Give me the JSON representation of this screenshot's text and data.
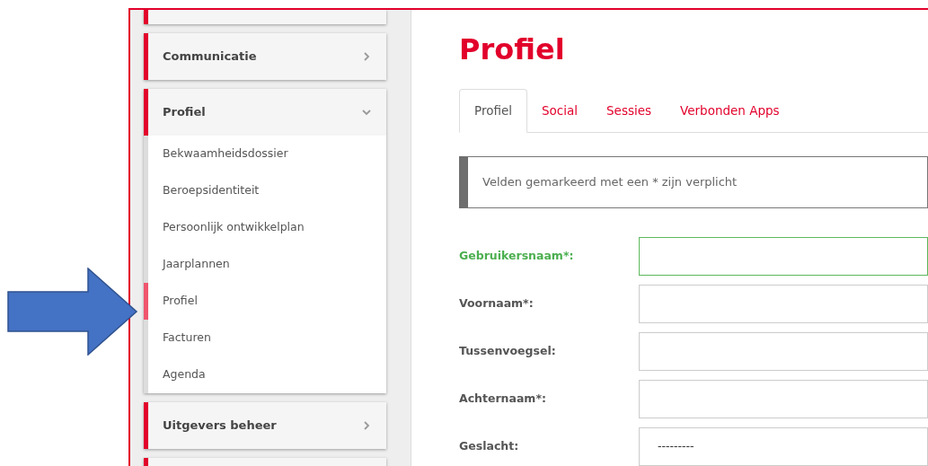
{
  "sidebar": {
    "groups": [
      {
        "label": "Communicatie",
        "expanded": false
      },
      {
        "label": "Profiel",
        "expanded": true,
        "items": [
          {
            "label": "Bekwaamheidsdossier",
            "selected": false
          },
          {
            "label": "Beroepsidentiteit",
            "selected": false
          },
          {
            "label": "Persoonlijk ontwikkelplan",
            "selected": false
          },
          {
            "label": "Jaarplannen",
            "selected": false
          },
          {
            "label": "Profiel",
            "selected": true
          },
          {
            "label": "Facturen",
            "selected": false
          },
          {
            "label": "Agenda",
            "selected": false
          }
        ]
      },
      {
        "label": "Uitgevers beheer",
        "expanded": false
      }
    ]
  },
  "page": {
    "title": "Profiel",
    "tabs": [
      {
        "label": "Profiel",
        "selected": true
      },
      {
        "label": "Social",
        "selected": false
      },
      {
        "label": "Sessies",
        "selected": false
      },
      {
        "label": "Verbonden Apps",
        "selected": false
      }
    ],
    "notice": "Velden gemarkeerd met een * zijn verplicht",
    "form": [
      {
        "kind": "text",
        "label": "Gebruikersnaam*:",
        "valid": true
      },
      {
        "kind": "text",
        "label": "Voornaam*:",
        "valid": false
      },
      {
        "kind": "text",
        "label": "Tussenvoegsel:",
        "valid": false
      },
      {
        "kind": "text",
        "label": "Achternaam*:",
        "valid": false
      },
      {
        "kind": "select",
        "label": "Geslacht:",
        "value": "---------",
        "valid": false
      }
    ]
  }
}
